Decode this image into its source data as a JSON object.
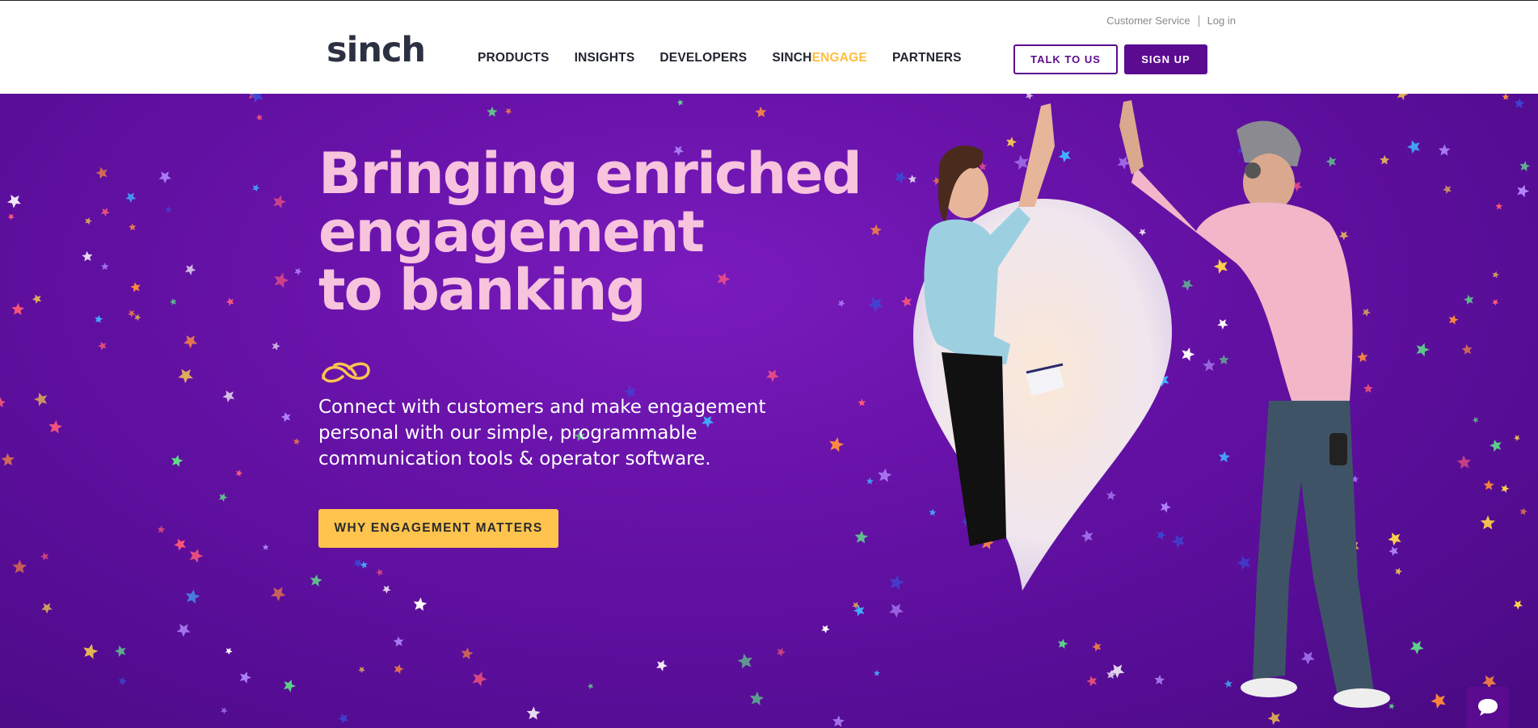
{
  "header": {
    "utility_links": [
      "Customer Service",
      "Log in"
    ],
    "logo_text": "sinch",
    "nav": {
      "products": "PRODUCTS",
      "insights": "INSIGHTS",
      "developers": "DEVELOPERS",
      "sinchengage_prefix": "SINCH",
      "sinchengage_suffix": "ENGAGE",
      "partners": "PARTNERS"
    },
    "talk_button": "TALK TO US",
    "signup_button": "SIGN UP"
  },
  "hero": {
    "headline_lines": [
      "Bringing enriched",
      "engagement",
      "to banking"
    ],
    "subtext": "Connect with customers and make engagement personal with our simple, programmable communication tools & operator software.",
    "cta_label": "WHY ENGAGEMENT MATTERS"
  },
  "colors": {
    "brand_purple": "#5a0b8f",
    "hero_background": "#6712a8",
    "headline_pink": "#f7c3dd",
    "accent_yellow": "#ffc44d",
    "engage_accent": "#ffbe3c"
  },
  "icons": [
    "infinity-loop-icon",
    "chat-bubble-icon"
  ]
}
